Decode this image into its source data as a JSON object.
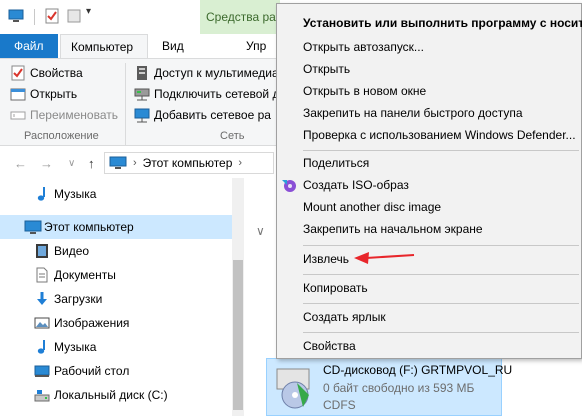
{
  "ribbon": {
    "contextual_tab": "Средства ра",
    "tabs": {
      "file": "Файл",
      "computer": "Компьютер",
      "view": "Вид",
      "manage": "Упр"
    },
    "location_group": {
      "properties": "Свойства",
      "open": "Открыть",
      "rename": "Переименовать",
      "label": "Расположение"
    },
    "network_group": {
      "media_access": "Доступ к мультимедиа",
      "map_drive": "Подключить сетевой д",
      "add_location": "Добавить сетевое ра",
      "label": "Сеть"
    }
  },
  "address": {
    "crumb": "Этот компьютер"
  },
  "nav_pane": {
    "items": [
      {
        "label": "Музыка",
        "icon": "music-note-icon"
      },
      {
        "label": "Этот компьютер",
        "icon": "computer-icon"
      },
      {
        "label": "Видео",
        "icon": "video-icon"
      },
      {
        "label": "Документы",
        "icon": "documents-icon"
      },
      {
        "label": "Загрузки",
        "icon": "download-arrow-icon"
      },
      {
        "label": "Изображения",
        "icon": "pictures-icon"
      },
      {
        "label": "Музыка",
        "icon": "music-note-icon"
      },
      {
        "label": "Рабочий стол",
        "icon": "desktop-icon"
      },
      {
        "label": "Локальный диск (C:)",
        "icon": "hard-drive-icon"
      }
    ]
  },
  "drive": {
    "name": "CD-дисковод (F:) GRTMPVOL_RU",
    "free": "0 байт свободно из 593 МБ",
    "fs": "CDFS"
  },
  "context_menu": {
    "items": [
      {
        "label": "Установить или выполнить программу с носителя",
        "bold": true
      },
      {
        "label": "Открыть автозапуск..."
      },
      {
        "label": "Открыть"
      },
      {
        "label": "Открыть в новом окне"
      },
      {
        "label": "Закрепить на панели быстрого доступа"
      },
      {
        "label": "Проверка с использованием Windows Defender..."
      },
      {
        "label": "Поделиться"
      },
      {
        "label": "Создать ISO-образ"
      },
      {
        "label": "Mount another disc image"
      },
      {
        "label": "Закрепить на начальном экране"
      },
      {
        "label": "Извлечь"
      },
      {
        "label": "Копировать"
      },
      {
        "label": "Создать ярлык"
      },
      {
        "label": "Свойства"
      }
    ]
  },
  "colors": {
    "file_tab": "#1979ca",
    "context_tab": "#d9efd2",
    "selection": "#cce8ff",
    "annotation_arrow": "#e8262b"
  }
}
